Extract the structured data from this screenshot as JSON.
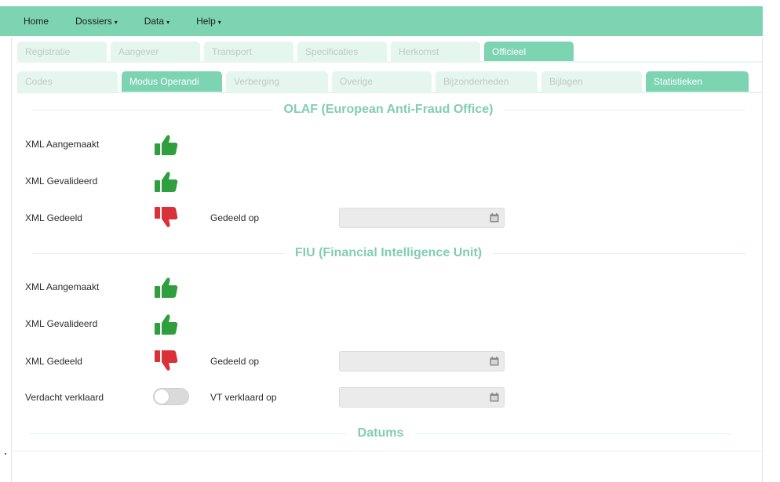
{
  "navbar": {
    "items": [
      {
        "label": "Home",
        "caret": ""
      },
      {
        "label": "Dossiers",
        "caret": "▾"
      },
      {
        "label": "Data",
        "caret": "▾"
      },
      {
        "label": "Help",
        "caret": "▾"
      }
    ],
    "color": "#7dd4b2"
  },
  "tabs_row1": [
    {
      "label": "Registratie",
      "active": false
    },
    {
      "label": "Aangever",
      "active": false
    },
    {
      "label": "Transport",
      "active": false
    },
    {
      "label": "Specificaties",
      "active": false
    },
    {
      "label": "Herkomst",
      "active": false
    },
    {
      "label": "Officieel",
      "active": true
    }
  ],
  "tabs_row2": [
    {
      "label": "Codes",
      "active": false
    },
    {
      "label": "Modus Operandi",
      "active": true
    },
    {
      "label": "Verberging",
      "active": false
    },
    {
      "label": "Overige",
      "active": false
    },
    {
      "label": "Bijzonderheden",
      "active": false
    },
    {
      "label": "Bijlagen",
      "active": false
    },
    {
      "label": "Statistieken",
      "active": true
    }
  ],
  "olaf": {
    "title": "OLAF (European Anti-Fraud Office)",
    "aangemaakt_label": "XML Aangemaakt",
    "aangemaakt_status": "thumbs-up",
    "gevalideerd_label": "XML Gevalideerd",
    "gevalideerd_status": "thumbs-up",
    "gedeeld_label": "XML Gedeeld",
    "gedeeld_status": "thumbs-down",
    "gedeeld_op_label": "Gedeeld op",
    "gedeeld_op_value": ""
  },
  "fiu": {
    "title": "FIU (Financial Intelligence Unit)",
    "aangemaakt_label": "XML Aangemaakt",
    "aangemaakt_status": "thumbs-up",
    "gevalideerd_label": "XML Gevalideerd",
    "gevalideerd_status": "thumbs-up",
    "gedeeld_label": "XML Gedeeld",
    "gedeeld_status": "thumbs-down",
    "gedeeld_op_label": "Gedeeld op",
    "gedeeld_op_value": "",
    "verdacht_label": "Verdacht verklaard",
    "verdacht_toggle": false,
    "vt_label": "VT verklaard op",
    "vt_value": ""
  },
  "datums": {
    "title": "Datums"
  },
  "colors": {
    "accent": "#7dd4b2",
    "thumbs_up": "#2e9e3e",
    "thumbs_down": "#d9303a"
  }
}
